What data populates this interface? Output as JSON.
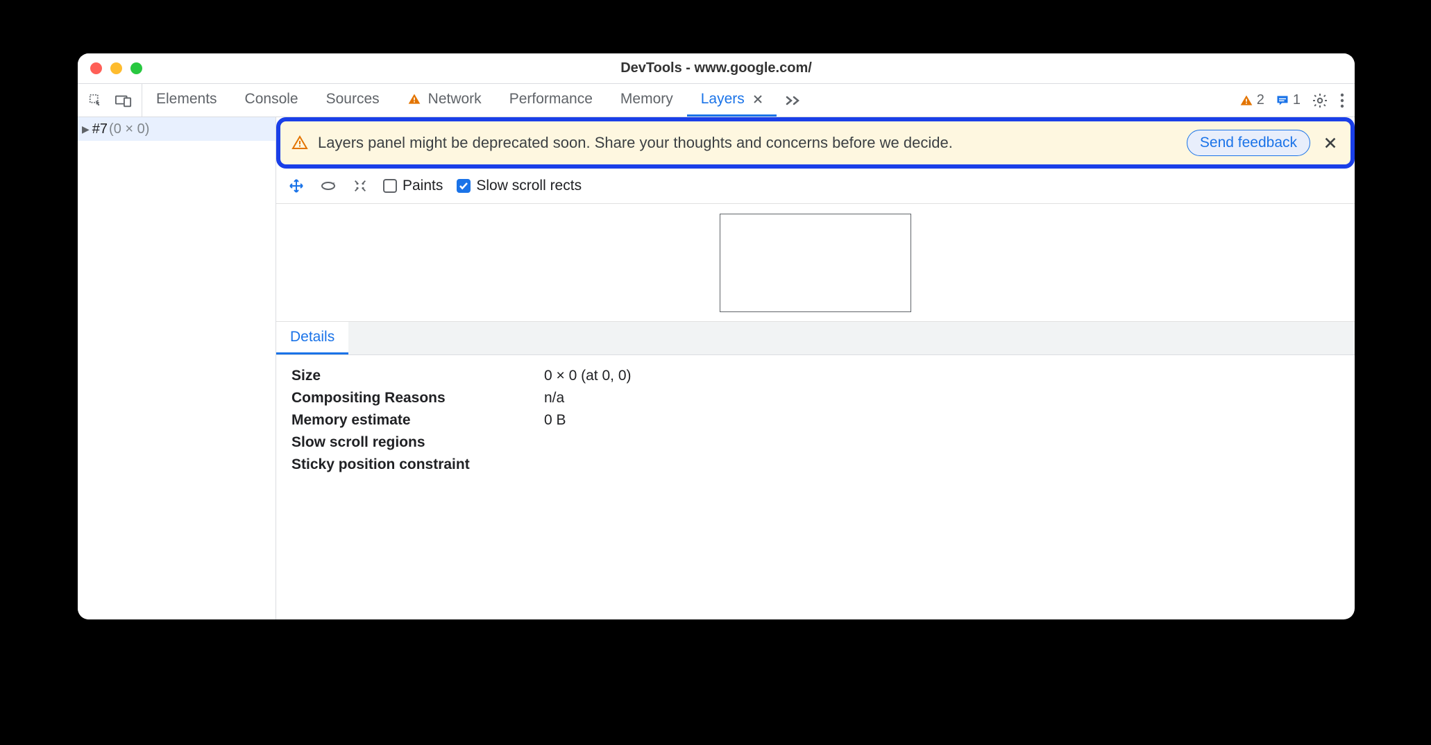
{
  "window": {
    "title": "DevTools - www.google.com/"
  },
  "tabs": {
    "elements": "Elements",
    "console": "Console",
    "sources": "Sources",
    "network": "Network",
    "performance": "Performance",
    "memory": "Memory",
    "layers": "Layers"
  },
  "counters": {
    "warnings": "2",
    "messages": "1"
  },
  "tree": {
    "item0_name": "#7",
    "item0_dim": "(0 × 0)"
  },
  "banner": {
    "text": "Layers panel might be deprecated soon. Share your thoughts and concerns before we decide.",
    "button": "Send feedback"
  },
  "controls": {
    "paints_label": "Paints",
    "slow_label": "Slow scroll rects"
  },
  "details": {
    "tab": "Details",
    "rows": {
      "size_k": "Size",
      "size_v": "0 × 0 (at 0, 0)",
      "comp_k": "Compositing Reasons",
      "comp_v": "n/a",
      "mem_k": "Memory estimate",
      "mem_v": "0 B",
      "slow_k": "Slow scroll regions",
      "slow_v": "",
      "sticky_k": "Sticky position constraint",
      "sticky_v": ""
    }
  }
}
